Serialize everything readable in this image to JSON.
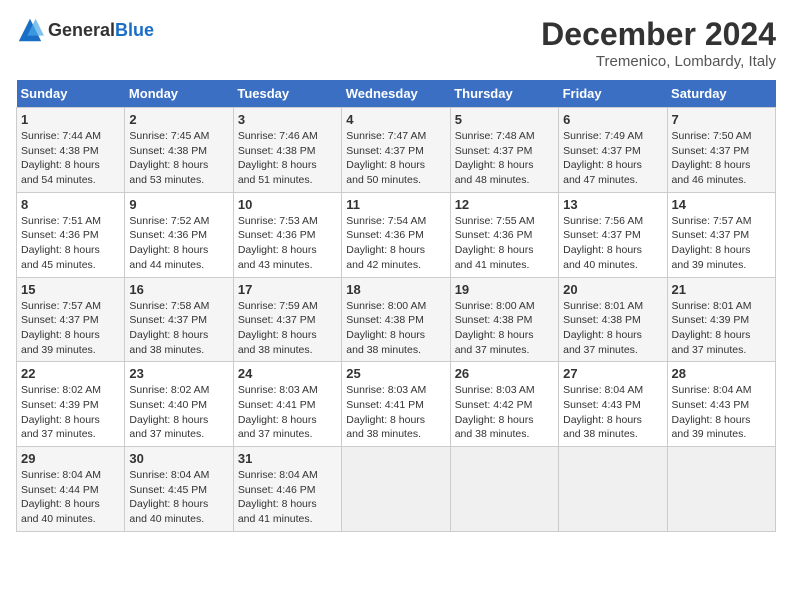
{
  "header": {
    "logo_general": "General",
    "logo_blue": "Blue",
    "title": "December 2024",
    "subtitle": "Tremenico, Lombardy, Italy"
  },
  "days_of_week": [
    "Sunday",
    "Monday",
    "Tuesday",
    "Wednesday",
    "Thursday",
    "Friday",
    "Saturday"
  ],
  "weeks": [
    [
      {
        "day": "1",
        "sunrise": "7:44 AM",
        "sunset": "4:38 PM",
        "daylight": "8 hours and 54 minutes."
      },
      {
        "day": "2",
        "sunrise": "7:45 AM",
        "sunset": "4:38 PM",
        "daylight": "8 hours and 53 minutes."
      },
      {
        "day": "3",
        "sunrise": "7:46 AM",
        "sunset": "4:38 PM",
        "daylight": "8 hours and 51 minutes."
      },
      {
        "day": "4",
        "sunrise": "7:47 AM",
        "sunset": "4:37 PM",
        "daylight": "8 hours and 50 minutes."
      },
      {
        "day": "5",
        "sunrise": "7:48 AM",
        "sunset": "4:37 PM",
        "daylight": "8 hours and 48 minutes."
      },
      {
        "day": "6",
        "sunrise": "7:49 AM",
        "sunset": "4:37 PM",
        "daylight": "8 hours and 47 minutes."
      },
      {
        "day": "7",
        "sunrise": "7:50 AM",
        "sunset": "4:37 PM",
        "daylight": "8 hours and 46 minutes."
      }
    ],
    [
      {
        "day": "8",
        "sunrise": "7:51 AM",
        "sunset": "4:36 PM",
        "daylight": "8 hours and 45 minutes."
      },
      {
        "day": "9",
        "sunrise": "7:52 AM",
        "sunset": "4:36 PM",
        "daylight": "8 hours and 44 minutes."
      },
      {
        "day": "10",
        "sunrise": "7:53 AM",
        "sunset": "4:36 PM",
        "daylight": "8 hours and 43 minutes."
      },
      {
        "day": "11",
        "sunrise": "7:54 AM",
        "sunset": "4:36 PM",
        "daylight": "8 hours and 42 minutes."
      },
      {
        "day": "12",
        "sunrise": "7:55 AM",
        "sunset": "4:36 PM",
        "daylight": "8 hours and 41 minutes."
      },
      {
        "day": "13",
        "sunrise": "7:56 AM",
        "sunset": "4:37 PM",
        "daylight": "8 hours and 40 minutes."
      },
      {
        "day": "14",
        "sunrise": "7:57 AM",
        "sunset": "4:37 PM",
        "daylight": "8 hours and 39 minutes."
      }
    ],
    [
      {
        "day": "15",
        "sunrise": "7:57 AM",
        "sunset": "4:37 PM",
        "daylight": "8 hours and 39 minutes."
      },
      {
        "day": "16",
        "sunrise": "7:58 AM",
        "sunset": "4:37 PM",
        "daylight": "8 hours and 38 minutes."
      },
      {
        "day": "17",
        "sunrise": "7:59 AM",
        "sunset": "4:37 PM",
        "daylight": "8 hours and 38 minutes."
      },
      {
        "day": "18",
        "sunrise": "8:00 AM",
        "sunset": "4:38 PM",
        "daylight": "8 hours and 38 minutes."
      },
      {
        "day": "19",
        "sunrise": "8:00 AM",
        "sunset": "4:38 PM",
        "daylight": "8 hours and 37 minutes."
      },
      {
        "day": "20",
        "sunrise": "8:01 AM",
        "sunset": "4:38 PM",
        "daylight": "8 hours and 37 minutes."
      },
      {
        "day": "21",
        "sunrise": "8:01 AM",
        "sunset": "4:39 PM",
        "daylight": "8 hours and 37 minutes."
      }
    ],
    [
      {
        "day": "22",
        "sunrise": "8:02 AM",
        "sunset": "4:39 PM",
        "daylight": "8 hours and 37 minutes."
      },
      {
        "day": "23",
        "sunrise": "8:02 AM",
        "sunset": "4:40 PM",
        "daylight": "8 hours and 37 minutes."
      },
      {
        "day": "24",
        "sunrise": "8:03 AM",
        "sunset": "4:41 PM",
        "daylight": "8 hours and 37 minutes."
      },
      {
        "day": "25",
        "sunrise": "8:03 AM",
        "sunset": "4:41 PM",
        "daylight": "8 hours and 38 minutes."
      },
      {
        "day": "26",
        "sunrise": "8:03 AM",
        "sunset": "4:42 PM",
        "daylight": "8 hours and 38 minutes."
      },
      {
        "day": "27",
        "sunrise": "8:04 AM",
        "sunset": "4:43 PM",
        "daylight": "8 hours and 38 minutes."
      },
      {
        "day": "28",
        "sunrise": "8:04 AM",
        "sunset": "4:43 PM",
        "daylight": "8 hours and 39 minutes."
      }
    ],
    [
      {
        "day": "29",
        "sunrise": "8:04 AM",
        "sunset": "4:44 PM",
        "daylight": "8 hours and 40 minutes."
      },
      {
        "day": "30",
        "sunrise": "8:04 AM",
        "sunset": "4:45 PM",
        "daylight": "8 hours and 40 minutes."
      },
      {
        "day": "31",
        "sunrise": "8:04 AM",
        "sunset": "4:46 PM",
        "daylight": "8 hours and 41 minutes."
      },
      null,
      null,
      null,
      null
    ]
  ]
}
